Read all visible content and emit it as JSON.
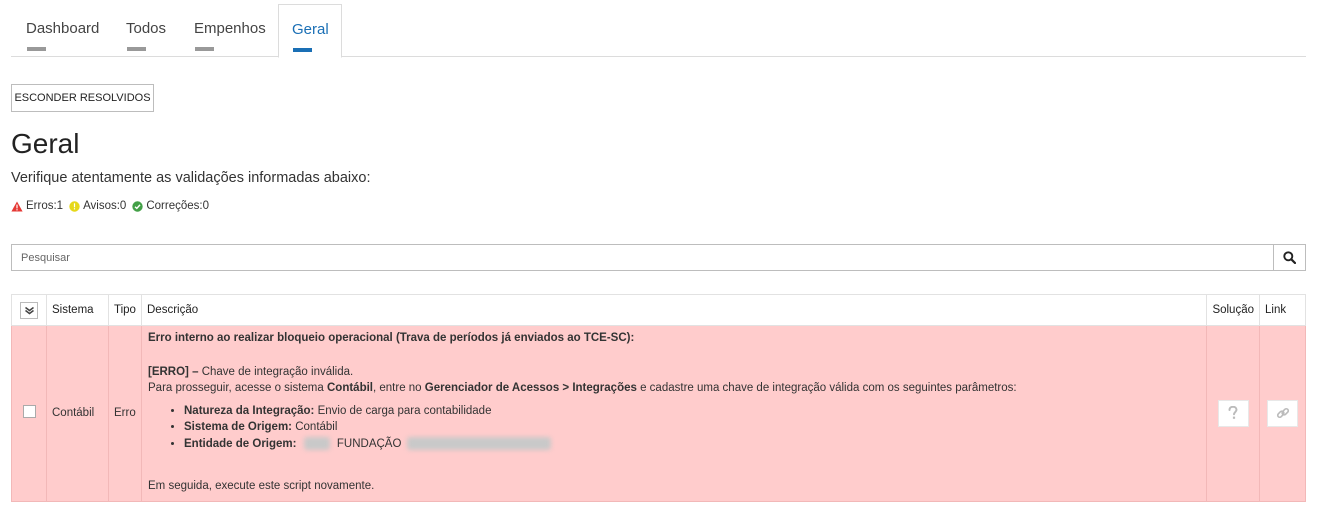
{
  "tabs": [
    {
      "label": "Dashboard"
    },
    {
      "label": "Todos"
    },
    {
      "label": "Empenhos"
    },
    {
      "label": "Geral"
    }
  ],
  "toolbar": {
    "hide_resolved_label": "ESCONDER RESOLVIDOS"
  },
  "page": {
    "title": "Geral",
    "subtitle": "Verifique atentamente as validações informadas abaixo:"
  },
  "counters": {
    "errors": "Erros:1",
    "warnings": "Avisos:0",
    "corrections": "Correções:0",
    "colors": {
      "error": "#e53935",
      "warning": "#e6d81a",
      "correction": "#43a047"
    }
  },
  "search": {
    "placeholder": "Pesquisar"
  },
  "table": {
    "headers": {
      "sistema": "Sistema",
      "tipo": "Tipo",
      "descricao": "Descrição",
      "solucao": "Solução",
      "link": "Link"
    },
    "rows": [
      {
        "sistema": "Contábil",
        "tipo": "Erro",
        "title": "Erro interno ao realizar bloqueio operacional (Trava de períodos já enviados ao TCE-SC):",
        "error_tag": "[ERRO] –",
        "error_msg": "Chave de integração inválida.",
        "instr_1": "Para prosseguir, acesse o sistema",
        "instr_sys": "Contábil",
        "instr_2": ", entre no",
        "instr_path": "Gerenciador de Acessos > Integrações",
        "instr_3": "e cadastre uma chave de integração válida com os seguintes parâmetros:",
        "params": [
          {
            "label": "Natureza da Integração:",
            "value": "Envio de carga para contabilidade"
          },
          {
            "label": "Sistema de Origem:",
            "value": "Contábil"
          },
          {
            "label": "Entidade de Origem:",
            "value": "FUNDAÇÃO"
          }
        ],
        "footer": "Em seguida, execute este script novamente.",
        "row_color": "#ffcccc"
      }
    ]
  },
  "icons": {
    "check_all": "double-check-icon",
    "search": "search-icon",
    "solution": "question-icon",
    "link": "link-icon"
  },
  "colors": {
    "accent": "#1a6fb5"
  }
}
